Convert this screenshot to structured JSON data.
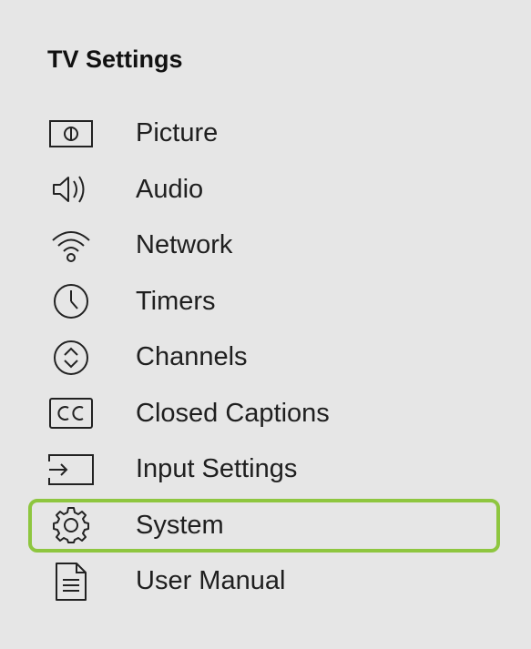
{
  "colors": {
    "background": "#e6e6e6",
    "accent": "#8ec63f",
    "text": "#1f1f1f"
  },
  "header": {
    "title": "TV Settings"
  },
  "menu": {
    "selected_index": 7,
    "items": [
      {
        "label": "Picture",
        "icon": "picture-icon"
      },
      {
        "label": "Audio",
        "icon": "speaker-icon"
      },
      {
        "label": "Network",
        "icon": "wifi-icon"
      },
      {
        "label": "Timers",
        "icon": "clock-icon"
      },
      {
        "label": "Channels",
        "icon": "channels-icon"
      },
      {
        "label": "Closed Captions",
        "icon": "cc-icon"
      },
      {
        "label": "Input Settings",
        "icon": "input-icon"
      },
      {
        "label": "System",
        "icon": "gear-icon"
      },
      {
        "label": "User Manual",
        "icon": "document-icon"
      }
    ]
  }
}
